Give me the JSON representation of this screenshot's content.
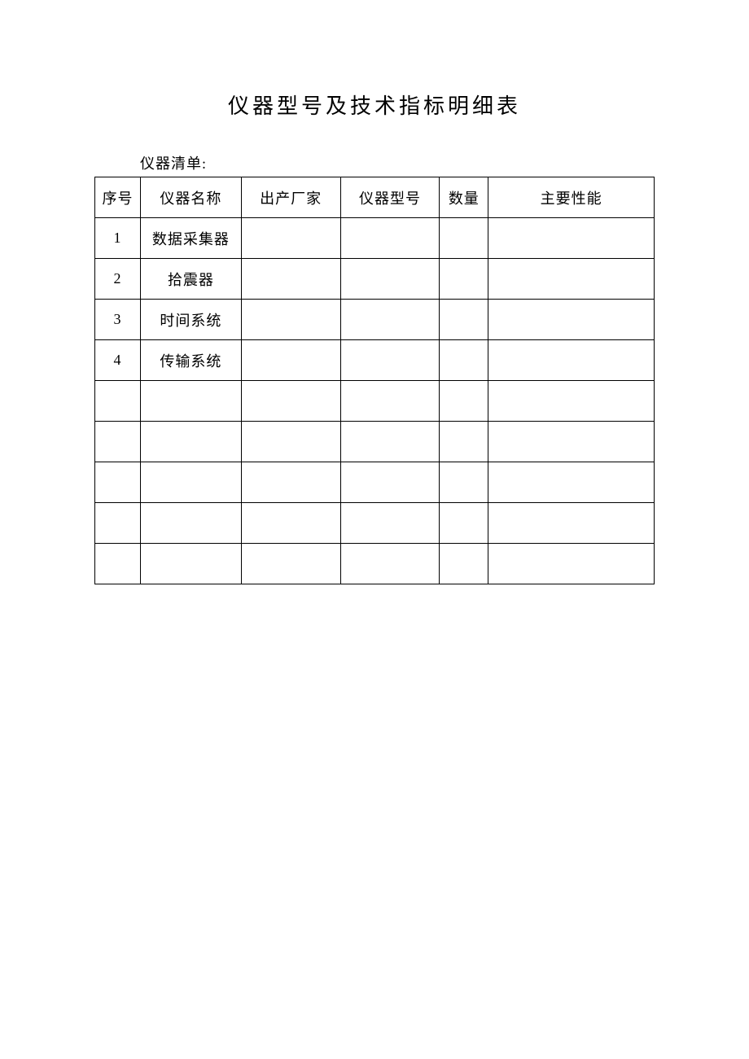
{
  "title": "仪器型号及技术指标明细表",
  "subtitle": "仪器清单:",
  "headers": {
    "col1": "序号",
    "col2": "仪器名称",
    "col3": "出产厂家",
    "col4": "仪器型号",
    "col5": "数量",
    "col6": "主要性能"
  },
  "rows": [
    {
      "seq": "1",
      "name": "数据采集器",
      "manufacturer": "",
      "model": "",
      "quantity": "",
      "performance": ""
    },
    {
      "seq": "2",
      "name": "拾震器",
      "manufacturer": "",
      "model": "",
      "quantity": "",
      "performance": ""
    },
    {
      "seq": "3",
      "name": "时间系统",
      "manufacturer": "",
      "model": "",
      "quantity": "",
      "performance": ""
    },
    {
      "seq": "4",
      "name": "传输系统",
      "manufacturer": "",
      "model": "",
      "quantity": "",
      "performance": ""
    },
    {
      "seq": "",
      "name": "",
      "manufacturer": "",
      "model": "",
      "quantity": "",
      "performance": ""
    },
    {
      "seq": "",
      "name": "",
      "manufacturer": "",
      "model": "",
      "quantity": "",
      "performance": ""
    },
    {
      "seq": "",
      "name": "",
      "manufacturer": "",
      "model": "",
      "quantity": "",
      "performance": ""
    },
    {
      "seq": "",
      "name": "",
      "manufacturer": "",
      "model": "",
      "quantity": "",
      "performance": ""
    },
    {
      "seq": "",
      "name": "",
      "manufacturer": "",
      "model": "",
      "quantity": "",
      "performance": ""
    }
  ]
}
